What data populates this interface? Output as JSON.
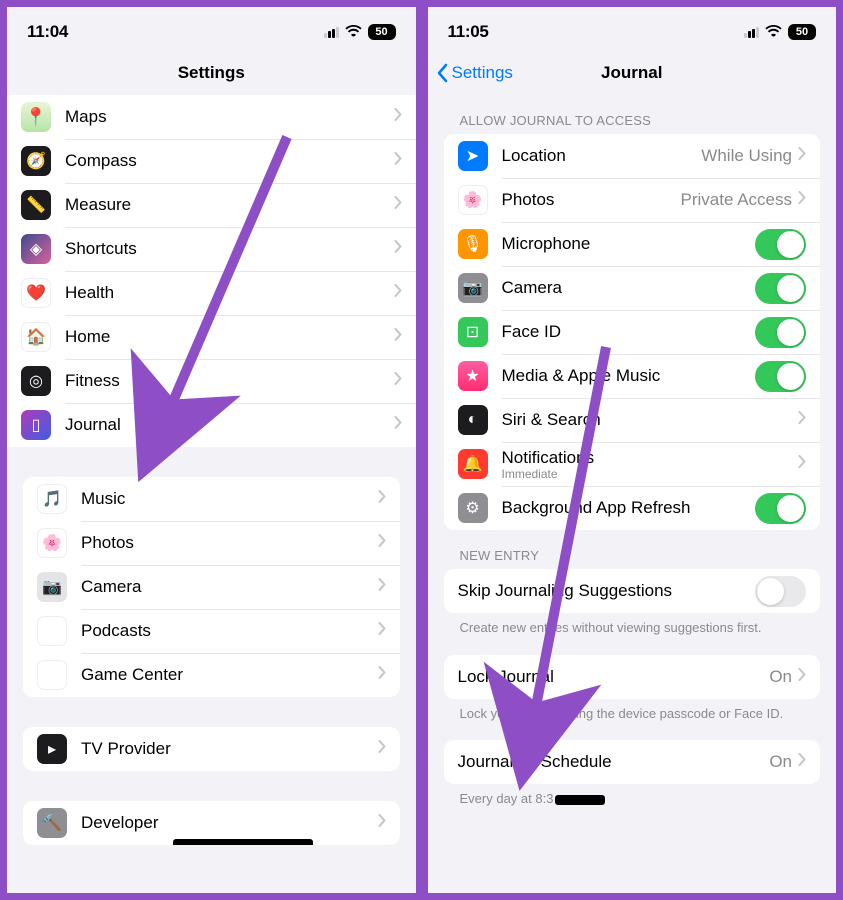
{
  "left": {
    "status": {
      "time": "11:04",
      "battery": "50"
    },
    "nav_title": "Settings",
    "groups": [
      {
        "style": "first",
        "items": [
          {
            "icon": "maps-icon",
            "iconcls": "ic-maps",
            "glyph": "📍",
            "label": "Maps"
          },
          {
            "icon": "compass-icon",
            "iconcls": "ic-compass",
            "glyph": "🧭",
            "label": "Compass"
          },
          {
            "icon": "measure-icon",
            "iconcls": "ic-measure",
            "glyph": "📏",
            "label": "Measure"
          },
          {
            "icon": "shortcuts-icon",
            "iconcls": "ic-shortcuts",
            "glyph": "◈",
            "label": "Shortcuts"
          },
          {
            "icon": "health-icon",
            "iconcls": "ic-health",
            "glyph": "❤️",
            "label": "Health"
          },
          {
            "icon": "home-icon",
            "iconcls": "ic-home",
            "glyph": "🏠",
            "label": "Home"
          },
          {
            "icon": "fitness-icon",
            "iconcls": "ic-fitness",
            "glyph": "◎",
            "label": "Fitness"
          },
          {
            "icon": "journal-icon",
            "iconcls": "ic-journal",
            "glyph": "▯",
            "label": "Journal"
          }
        ]
      },
      {
        "items": [
          {
            "icon": "music-icon",
            "iconcls": "ic-music",
            "glyph": "🎵",
            "label": "Music"
          },
          {
            "icon": "photos-icon",
            "iconcls": "ic-photos",
            "glyph": "🌸",
            "label": "Photos"
          },
          {
            "icon": "camera-icon",
            "iconcls": "ic-camera",
            "glyph": "📷",
            "label": "Camera"
          },
          {
            "icon": "podcasts-icon",
            "iconcls": "ic-podcasts",
            "glyph": "◉",
            "label": "Podcasts"
          },
          {
            "icon": "gamecenter-icon",
            "iconcls": "ic-gamecenter",
            "glyph": "✦",
            "label": "Game Center"
          }
        ]
      },
      {
        "items": [
          {
            "icon": "tvprovider-icon",
            "iconcls": "ic-tvprovider",
            "glyph": "▸",
            "label": "TV Provider"
          }
        ]
      },
      {
        "items": [
          {
            "icon": "developer-icon",
            "iconcls": "ic-developer",
            "glyph": "🔨",
            "label": "Developer"
          }
        ]
      }
    ]
  },
  "right": {
    "status": {
      "time": "11:05",
      "battery": "50"
    },
    "nav_title": "Journal",
    "back_label": "Settings",
    "section_allow": "ALLOW JOURNAL TO ACCESS",
    "allow_items": [
      {
        "icon": "location-icon",
        "iconcls": "ic-location",
        "glyph": "➤",
        "label": "Location",
        "value": "While Using",
        "type": "link"
      },
      {
        "icon": "photos-icon",
        "iconcls": "ic-photos2",
        "glyph": "🌸",
        "label": "Photos",
        "value": "Private Access",
        "type": "link"
      },
      {
        "icon": "microphone-icon",
        "iconcls": "ic-mic",
        "glyph": "🎙",
        "label": "Microphone",
        "type": "toggle",
        "on": true
      },
      {
        "icon": "camera-icon",
        "iconcls": "ic-camera2",
        "glyph": "📷",
        "label": "Camera",
        "type": "toggle",
        "on": true
      },
      {
        "icon": "faceid-icon",
        "iconcls": "ic-faceid",
        "glyph": "⊡",
        "label": "Face ID",
        "type": "toggle",
        "on": true
      },
      {
        "icon": "media-icon",
        "iconcls": "ic-media",
        "glyph": "★",
        "label": "Media & Apple Music",
        "type": "toggle",
        "on": true
      },
      {
        "icon": "siri-icon",
        "iconcls": "ic-siri",
        "glyph": "◐",
        "label": "Siri & Search",
        "type": "link"
      },
      {
        "icon": "notifications-icon",
        "iconcls": "ic-notif",
        "glyph": "🔔",
        "label": "Notifications",
        "sub": "Immediate",
        "type": "link"
      },
      {
        "icon": "refresh-icon",
        "iconcls": "ic-refresh",
        "glyph": "⚙",
        "label": "Background App Refresh",
        "type": "toggle",
        "on": true
      }
    ],
    "section_newentry": "NEW ENTRY",
    "skip": {
      "label": "Skip Journaling Suggestions",
      "on": false
    },
    "skip_footer": "Create new entries without viewing suggestions first.",
    "lock": {
      "label": "Lock Journal",
      "value": "On"
    },
    "lock_footer": "Lock your journal using the device passcode or Face ID.",
    "schedule": {
      "label": "Journaling Schedule",
      "value": "On"
    },
    "schedule_footer_prefix": "Every day at 8:3"
  }
}
